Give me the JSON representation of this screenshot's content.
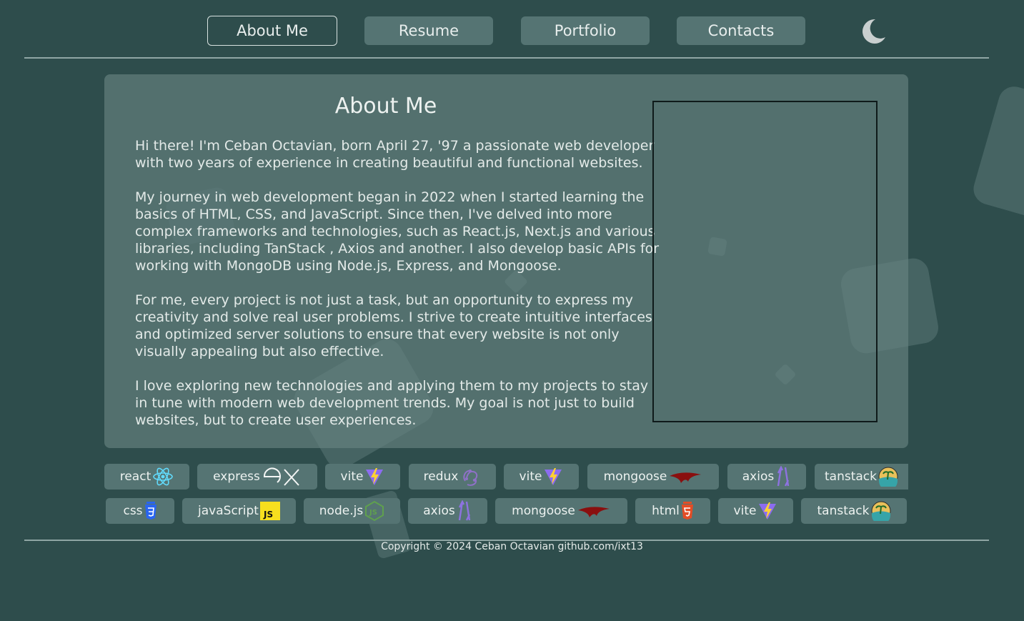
{
  "nav": {
    "about": "About Me",
    "resume": "Resume",
    "portfolio": "Portfolio",
    "contacts": "Contacts",
    "theme_icon": "moon-icon"
  },
  "about": {
    "title": "About Me",
    "paragraphs": [
      [
        "Hi there! I'm Ceban Octavian, born April 27, '97 a passionate web developer",
        "with two years of experience in creating beautiful and functional websites."
      ],
      [
        "My journey in web development began in 2022 when I started learning the",
        "basics of HTML, CSS, and JavaScript. Since then, I've delved into more",
        "complex frameworks and technologies, such as React.js, Next.js and various",
        "libraries, including TanStack , Axios and another. I also develop basic APIs for",
        "working with MongoDB using Node.js, Express, and Mongoose."
      ],
      [
        "For me, every project is not just a task, but an opportunity to express my",
        "creativity and solve real user problems. I strive to create intuitive interfaces",
        "and optimized server solutions to ensure that every website is not only",
        "visually appealing but also effective."
      ],
      [
        "I love exploring new technologies and applying them to my projects to stay",
        "in tune with modern web development trends. My goal is not just to build",
        "websites, but to create user experiences."
      ]
    ]
  },
  "skills": {
    "row1": [
      {
        "label": "react",
        "icon": "react-icon"
      },
      {
        "label": "express",
        "icon": "express-icon"
      },
      {
        "label": "vite",
        "icon": "vite-icon"
      },
      {
        "label": "redux",
        "icon": "redux-icon"
      },
      {
        "label": "vite",
        "icon": "vite-icon"
      },
      {
        "label": "mongoose",
        "icon": "mongoose-icon"
      },
      {
        "label": "axios",
        "icon": "axios-icon"
      },
      {
        "label": "tanstack",
        "icon": "tanstack-icon"
      }
    ],
    "row2": [
      {
        "label": "css",
        "icon": "css-icon"
      },
      {
        "label": "javaScript",
        "icon": "javascript-icon"
      },
      {
        "label": "node.js",
        "icon": "nodejs-icon"
      },
      {
        "label": "axios",
        "icon": "axios-icon"
      },
      {
        "label": "mongoose",
        "icon": "mongoose-icon"
      },
      {
        "label": "html",
        "icon": "html-icon"
      },
      {
        "label": "vite",
        "icon": "vite-icon"
      },
      {
        "label": "tanstack",
        "icon": "tanstack-icon"
      }
    ]
  },
  "footer": {
    "copyright": "Copyright © 2024 Ceban Octavian github.com/ixt13"
  },
  "colors": {
    "background": "#2e4d4c",
    "card": "#5f7b79",
    "button": "#557473",
    "text": "#e6ecea"
  }
}
